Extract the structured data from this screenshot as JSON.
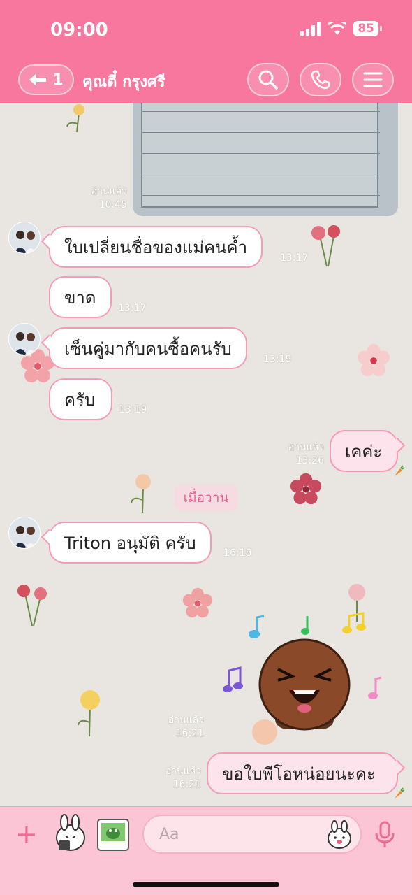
{
  "status_bar": {
    "time": "09:00",
    "battery": "85"
  },
  "header": {
    "back_count": "1",
    "title": "คุณตี๋ กรุงศรี",
    "search_icon": "search-icon",
    "call_icon": "phone-icon",
    "menu_icon": "menu-icon"
  },
  "messages": {
    "photo": {
      "read": "อ่านแล้ว",
      "time": "10:45"
    },
    "m1": {
      "text": "ใบเปลี่ยนชื่อของแม่คนค้ำ",
      "time": "13:17"
    },
    "m2": {
      "text": "ขาด",
      "time": "13:17"
    },
    "m3": {
      "text": "เซ็นคู่มากับคนซื้อคนรับ",
      "time": "13:19"
    },
    "m4": {
      "text": "ครับ",
      "time": "13:19"
    },
    "m5": {
      "text": "เคค่ะ",
      "read": "อ่านแล้ว",
      "time": "13:26"
    },
    "date_divider": "เมื่อวาน",
    "m6": {
      "text": "Triton อนุมัติ ครับ",
      "time": "16:18"
    },
    "sticker": {
      "read": "อ่านแล้ว",
      "time": "16:21"
    },
    "m7": {
      "text": "ขอใบพีโอหน่อยนะคะ",
      "read": "อ่านแล้ว",
      "time": "16:21"
    }
  },
  "input": {
    "placeholder": "Aa"
  },
  "colors": {
    "accent": "#f7779f",
    "bubble_border": "#f49bb8",
    "outgoing_bg": "#fde3ec",
    "input_bar": "#fcc5d6"
  }
}
